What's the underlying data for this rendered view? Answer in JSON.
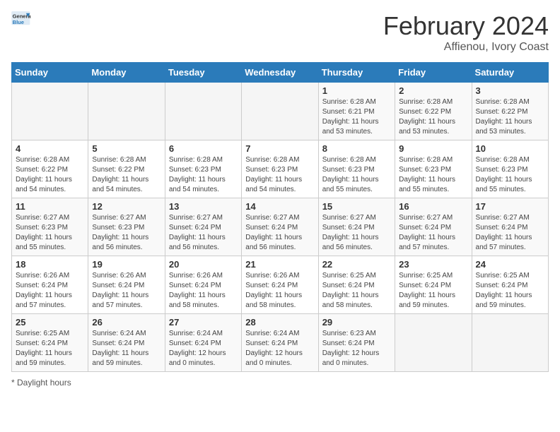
{
  "header": {
    "logo_general": "General",
    "logo_blue": "Blue",
    "title": "February 2024",
    "subtitle": "Affienou, Ivory Coast"
  },
  "days_of_week": [
    "Sunday",
    "Monday",
    "Tuesday",
    "Wednesday",
    "Thursday",
    "Friday",
    "Saturday"
  ],
  "weeks": [
    [
      {
        "day": "",
        "sunrise": "",
        "sunset": "",
        "daylight": "",
        "empty": true
      },
      {
        "day": "",
        "sunrise": "",
        "sunset": "",
        "daylight": "",
        "empty": true
      },
      {
        "day": "",
        "sunrise": "",
        "sunset": "",
        "daylight": "",
        "empty": true
      },
      {
        "day": "",
        "sunrise": "",
        "sunset": "",
        "daylight": "",
        "empty": true
      },
      {
        "day": "1",
        "sunrise": "Sunrise: 6:28 AM",
        "sunset": "Sunset: 6:21 PM",
        "daylight": "Daylight: 11 hours and 53 minutes."
      },
      {
        "day": "2",
        "sunrise": "Sunrise: 6:28 AM",
        "sunset": "Sunset: 6:22 PM",
        "daylight": "Daylight: 11 hours and 53 minutes."
      },
      {
        "day": "3",
        "sunrise": "Sunrise: 6:28 AM",
        "sunset": "Sunset: 6:22 PM",
        "daylight": "Daylight: 11 hours and 53 minutes."
      }
    ],
    [
      {
        "day": "4",
        "sunrise": "Sunrise: 6:28 AM",
        "sunset": "Sunset: 6:22 PM",
        "daylight": "Daylight: 11 hours and 54 minutes."
      },
      {
        "day": "5",
        "sunrise": "Sunrise: 6:28 AM",
        "sunset": "Sunset: 6:22 PM",
        "daylight": "Daylight: 11 hours and 54 minutes."
      },
      {
        "day": "6",
        "sunrise": "Sunrise: 6:28 AM",
        "sunset": "Sunset: 6:23 PM",
        "daylight": "Daylight: 11 hours and 54 minutes."
      },
      {
        "day": "7",
        "sunrise": "Sunrise: 6:28 AM",
        "sunset": "Sunset: 6:23 PM",
        "daylight": "Daylight: 11 hours and 54 minutes."
      },
      {
        "day": "8",
        "sunrise": "Sunrise: 6:28 AM",
        "sunset": "Sunset: 6:23 PM",
        "daylight": "Daylight: 11 hours and 55 minutes."
      },
      {
        "day": "9",
        "sunrise": "Sunrise: 6:28 AM",
        "sunset": "Sunset: 6:23 PM",
        "daylight": "Daylight: 11 hours and 55 minutes."
      },
      {
        "day": "10",
        "sunrise": "Sunrise: 6:28 AM",
        "sunset": "Sunset: 6:23 PM",
        "daylight": "Daylight: 11 hours and 55 minutes."
      }
    ],
    [
      {
        "day": "11",
        "sunrise": "Sunrise: 6:27 AM",
        "sunset": "Sunset: 6:23 PM",
        "daylight": "Daylight: 11 hours and 55 minutes."
      },
      {
        "day": "12",
        "sunrise": "Sunrise: 6:27 AM",
        "sunset": "Sunset: 6:23 PM",
        "daylight": "Daylight: 11 hours and 56 minutes."
      },
      {
        "day": "13",
        "sunrise": "Sunrise: 6:27 AM",
        "sunset": "Sunset: 6:24 PM",
        "daylight": "Daylight: 11 hours and 56 minutes."
      },
      {
        "day": "14",
        "sunrise": "Sunrise: 6:27 AM",
        "sunset": "Sunset: 6:24 PM",
        "daylight": "Daylight: 11 hours and 56 minutes."
      },
      {
        "day": "15",
        "sunrise": "Sunrise: 6:27 AM",
        "sunset": "Sunset: 6:24 PM",
        "daylight": "Daylight: 11 hours and 56 minutes."
      },
      {
        "day": "16",
        "sunrise": "Sunrise: 6:27 AM",
        "sunset": "Sunset: 6:24 PM",
        "daylight": "Daylight: 11 hours and 57 minutes."
      },
      {
        "day": "17",
        "sunrise": "Sunrise: 6:27 AM",
        "sunset": "Sunset: 6:24 PM",
        "daylight": "Daylight: 11 hours and 57 minutes."
      }
    ],
    [
      {
        "day": "18",
        "sunrise": "Sunrise: 6:26 AM",
        "sunset": "Sunset: 6:24 PM",
        "daylight": "Daylight: 11 hours and 57 minutes."
      },
      {
        "day": "19",
        "sunrise": "Sunrise: 6:26 AM",
        "sunset": "Sunset: 6:24 PM",
        "daylight": "Daylight: 11 hours and 57 minutes."
      },
      {
        "day": "20",
        "sunrise": "Sunrise: 6:26 AM",
        "sunset": "Sunset: 6:24 PM",
        "daylight": "Daylight: 11 hours and 58 minutes."
      },
      {
        "day": "21",
        "sunrise": "Sunrise: 6:26 AM",
        "sunset": "Sunset: 6:24 PM",
        "daylight": "Daylight: 11 hours and 58 minutes."
      },
      {
        "day": "22",
        "sunrise": "Sunrise: 6:25 AM",
        "sunset": "Sunset: 6:24 PM",
        "daylight": "Daylight: 11 hours and 58 minutes."
      },
      {
        "day": "23",
        "sunrise": "Sunrise: 6:25 AM",
        "sunset": "Sunset: 6:24 PM",
        "daylight": "Daylight: 11 hours and 59 minutes."
      },
      {
        "day": "24",
        "sunrise": "Sunrise: 6:25 AM",
        "sunset": "Sunset: 6:24 PM",
        "daylight": "Daylight: 11 hours and 59 minutes."
      }
    ],
    [
      {
        "day": "25",
        "sunrise": "Sunrise: 6:25 AM",
        "sunset": "Sunset: 6:24 PM",
        "daylight": "Daylight: 11 hours and 59 minutes."
      },
      {
        "day": "26",
        "sunrise": "Sunrise: 6:24 AM",
        "sunset": "Sunset: 6:24 PM",
        "daylight": "Daylight: 11 hours and 59 minutes."
      },
      {
        "day": "27",
        "sunrise": "Sunrise: 6:24 AM",
        "sunset": "Sunset: 6:24 PM",
        "daylight": "Daylight: 12 hours and 0 minutes."
      },
      {
        "day": "28",
        "sunrise": "Sunrise: 6:24 AM",
        "sunset": "Sunset: 6:24 PM",
        "daylight": "Daylight: 12 hours and 0 minutes."
      },
      {
        "day": "29",
        "sunrise": "Sunrise: 6:23 AM",
        "sunset": "Sunset: 6:24 PM",
        "daylight": "Daylight: 12 hours and 0 minutes."
      },
      {
        "day": "",
        "sunrise": "",
        "sunset": "",
        "daylight": "",
        "empty": true
      },
      {
        "day": "",
        "sunrise": "",
        "sunset": "",
        "daylight": "",
        "empty": true
      }
    ]
  ],
  "footer": {
    "note": "Daylight hours"
  }
}
